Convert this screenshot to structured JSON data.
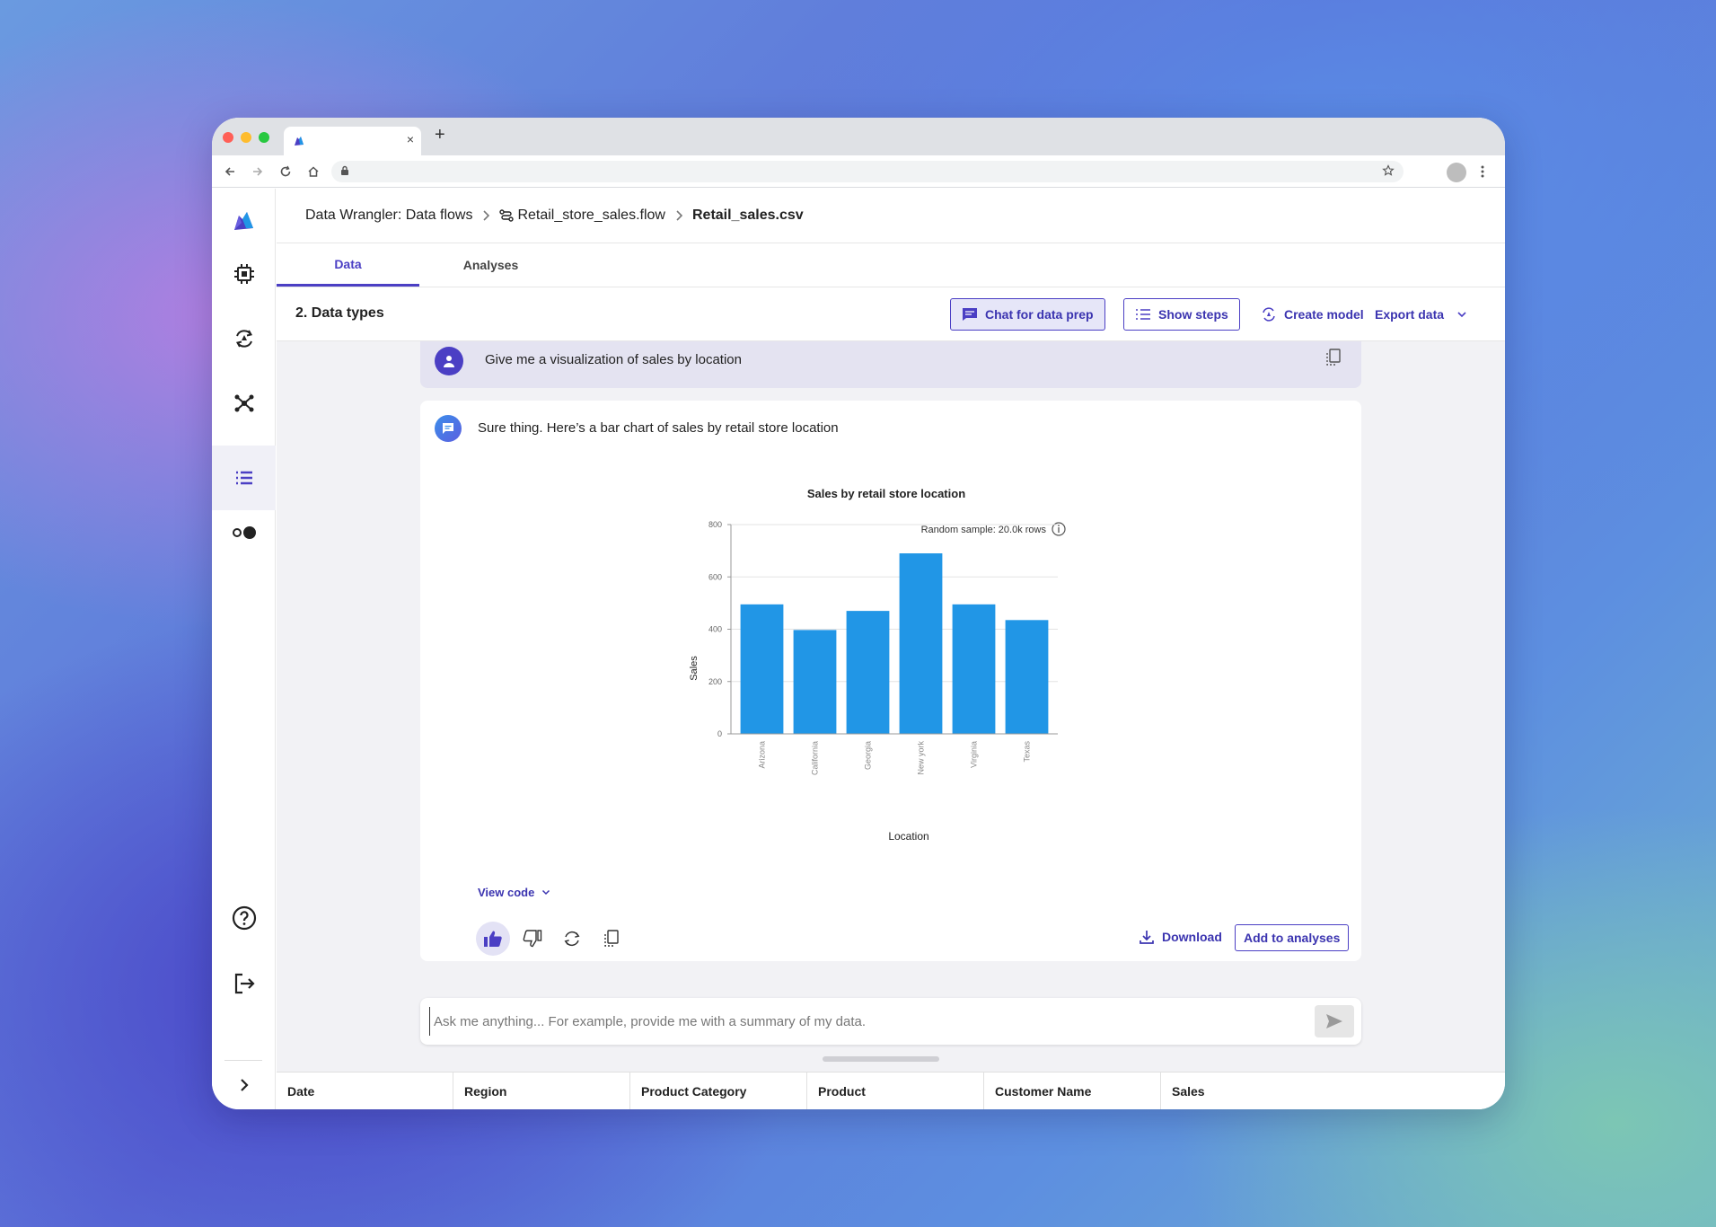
{
  "browser": {
    "tab_close": "×",
    "new_tab": "+"
  },
  "breadcrumb": {
    "root": "Data Wrangler: Data flows",
    "flow": "Retail_store_sales.flow",
    "file": "Retail_sales.csv"
  },
  "tabs": [
    {
      "label": "Data",
      "active": true
    },
    {
      "label": "Analyses",
      "active": false
    }
  ],
  "subheader": {
    "step_title": "2. Data types",
    "chat_button": "Chat for data prep",
    "steps_button": "Show steps",
    "create_model": "Create model",
    "export_data": "Export data"
  },
  "chat": {
    "user_message": "Give me a visualization of sales by location",
    "bot_message": "Sure thing. Here’s a bar chart of sales by retail store location",
    "view_code": "View code",
    "download": "Download",
    "add_to_analyses": "Add to analyses",
    "input_placeholder": "Ask me anything... For example, provide me with a summary of my data."
  },
  "chart_data": {
    "type": "bar",
    "title": "Sales by retail store location",
    "annotation": "Random sample: 20.0k rows",
    "xlabel": "Location",
    "ylabel": "Sales",
    "categories": [
      "Arizona",
      "California",
      "Georgia",
      "New york",
      "Virginia",
      "Texas"
    ],
    "values": [
      495,
      397,
      470,
      690,
      495,
      435
    ],
    "ylim": [
      0,
      800
    ],
    "yticks": [
      0,
      200,
      400,
      600,
      800
    ],
    "grid": true,
    "color": "#2196e6"
  },
  "table": {
    "columns": [
      "Date",
      "Region",
      "Product Category",
      "Product",
      "Customer Name",
      "Sales"
    ]
  },
  "colors": {
    "accent": "#4b3fc4",
    "bar": "#2196e6"
  }
}
